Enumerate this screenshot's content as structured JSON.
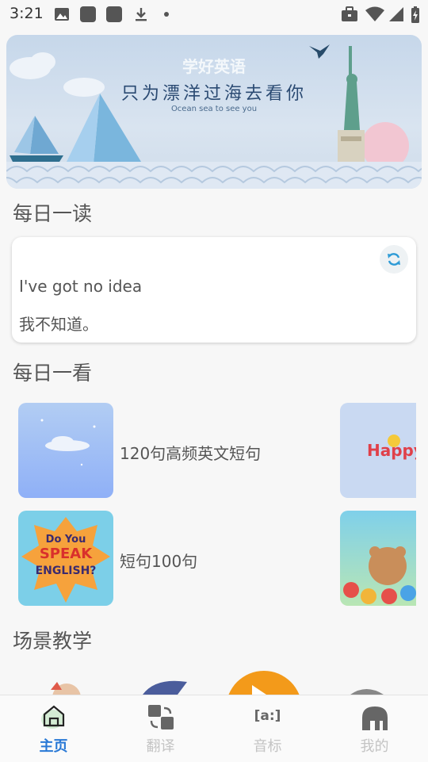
{
  "status_bar": {
    "time": "3:21"
  },
  "banner": {
    "title": "学好英语",
    "slogan": "只为漂洋过海去看你",
    "subtitle": "Ocean sea to see you"
  },
  "daily_read": {
    "title": "每日一读",
    "english": "I've got no idea",
    "chinese": "我不知道。"
  },
  "daily_look": {
    "title": "每日一看",
    "items": [
      {
        "label": "120句高频英文短句"
      },
      {
        "label": "短句100句"
      }
    ],
    "side_thumb_text": "Happy"
  },
  "scene_teaching": {
    "title": "场景教学"
  },
  "bottom_nav": {
    "items": [
      {
        "label": "主页",
        "icon": "home-icon",
        "active": true
      },
      {
        "label": "翻译",
        "icon": "translate-icon",
        "active": false
      },
      {
        "label": "音标",
        "icon": "phonetic-icon",
        "icon_text": "[a:]",
        "active": false
      },
      {
        "label": "我的",
        "icon": "elephant-icon",
        "active": false
      }
    ]
  },
  "colors": {
    "accent": "#2979d6",
    "inactive": "#c4c4c4",
    "background": "#f7f7f7"
  }
}
